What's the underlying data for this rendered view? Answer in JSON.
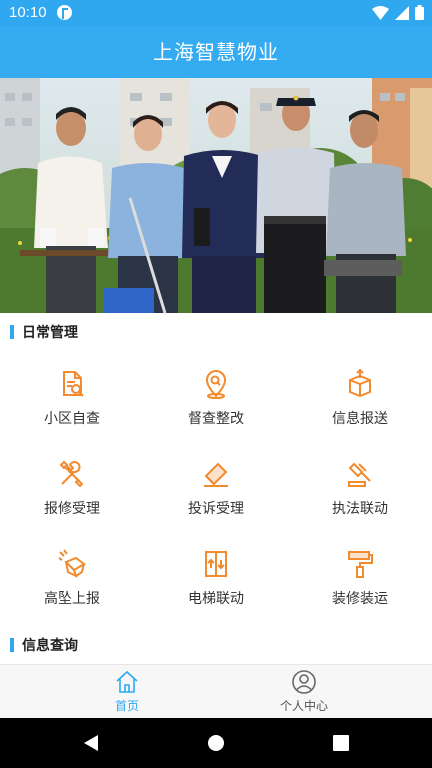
{
  "status_bar": {
    "time": "10:10"
  },
  "header": {
    "title": "上海智慧物业"
  },
  "sections": [
    {
      "title": "日常管理"
    },
    {
      "title": "信息查询"
    }
  ],
  "daily_management": {
    "items": [
      {
        "label": "小区自查",
        "icon": "document-search-icon"
      },
      {
        "label": "督查整改",
        "icon": "location-search-icon"
      },
      {
        "label": "信息报送",
        "icon": "box-upload-icon"
      },
      {
        "label": "报修受理",
        "icon": "tools-icon"
      },
      {
        "label": "投诉受理",
        "icon": "eraser-icon"
      },
      {
        "label": "执法联动",
        "icon": "gavel-icon"
      },
      {
        "label": "高坠上报",
        "icon": "falling-box-icon"
      },
      {
        "label": "电梯联动",
        "icon": "elevator-icon"
      },
      {
        "label": "装修装运",
        "icon": "paint-roller-icon"
      }
    ]
  },
  "bottom_nav": {
    "items": [
      {
        "label": "首页",
        "icon": "home-icon",
        "active": true
      },
      {
        "label": "个人中心",
        "icon": "user-icon",
        "active": false
      }
    ]
  },
  "colors": {
    "primary": "#2fa8f0",
    "icon_orange": "#f28a30"
  }
}
